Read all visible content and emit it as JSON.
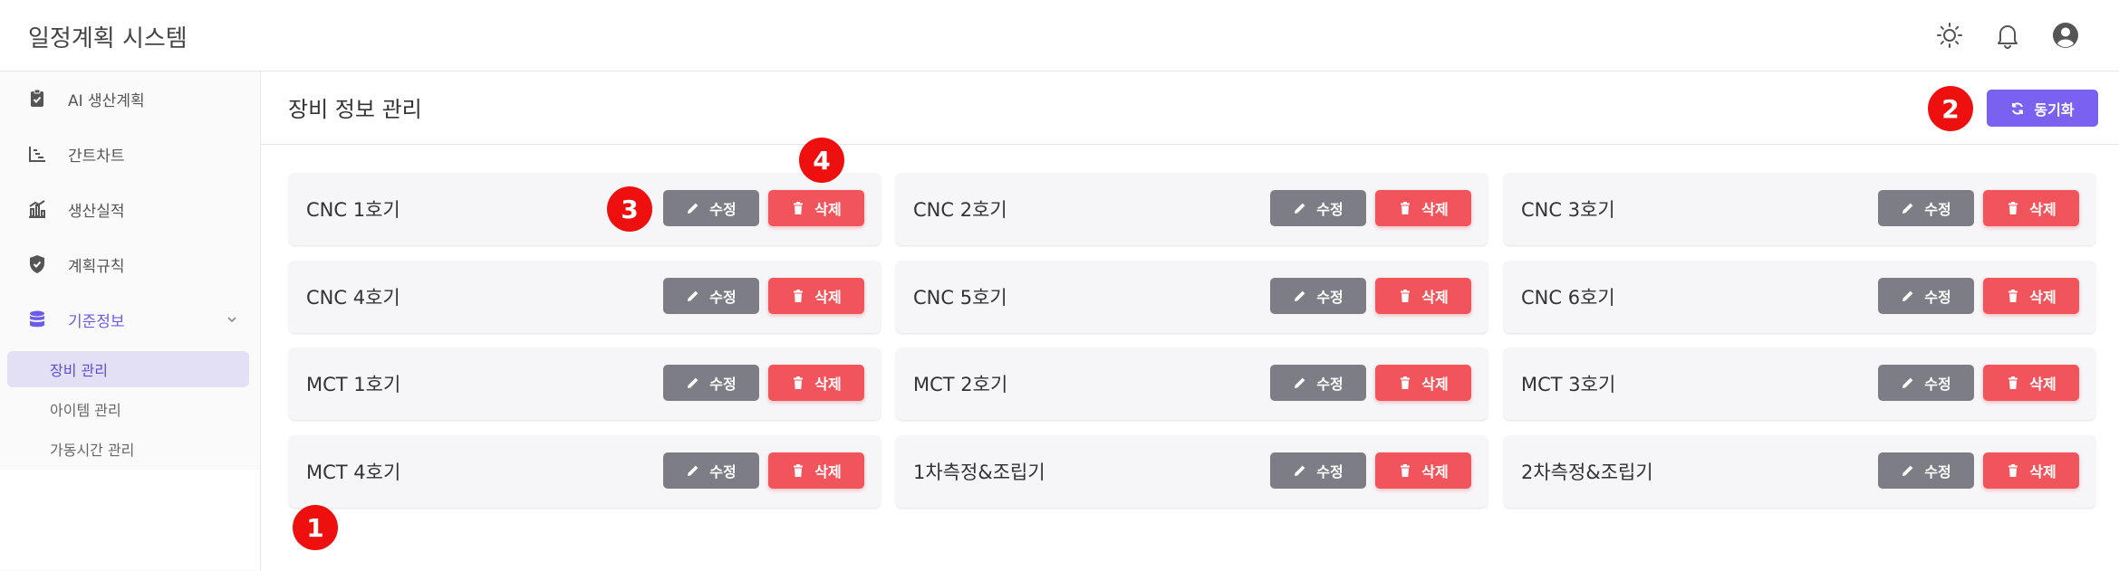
{
  "header": {
    "app_title": "일정계획 시스템",
    "icons": [
      "sun-icon",
      "bell-icon",
      "user-avatar-icon"
    ]
  },
  "sidebar": {
    "items": [
      {
        "label": "AI 생산계획",
        "icon": "clipboard-icon"
      },
      {
        "label": "간트차트",
        "icon": "chart-icon"
      },
      {
        "label": "생산실적",
        "icon": "bar-chart-icon"
      },
      {
        "label": "계획규칙",
        "icon": "shield-icon"
      },
      {
        "label": "기준정보",
        "icon": "database-icon"
      }
    ],
    "sub_items": [
      {
        "label": "장비 관리"
      },
      {
        "label": "아이템 관리"
      },
      {
        "label": "가동시간 관리"
      }
    ]
  },
  "main": {
    "page_title": "장비 정보 관리",
    "sync_label": "동기화",
    "edit_label": "수정",
    "delete_label": "삭제",
    "equipment": [
      {
        "name": "CNC 1호기"
      },
      {
        "name": "CNC 2호기"
      },
      {
        "name": "CNC 3호기"
      },
      {
        "name": "CNC 4호기"
      },
      {
        "name": "CNC 5호기"
      },
      {
        "name": "CNC 6호기"
      },
      {
        "name": "MCT 1호기"
      },
      {
        "name": "MCT 2호기"
      },
      {
        "name": "MCT 3호기"
      },
      {
        "name": "MCT 4호기"
      },
      {
        "name": "1차측정&조립기"
      },
      {
        "name": "2차측정&조립기"
      }
    ]
  },
  "markers": [
    "1",
    "2",
    "3",
    "4"
  ],
  "colors": {
    "accent": "#7b61f0",
    "edit": "#7d7d86",
    "delete": "#f2545b",
    "marker": "#ee0f0f"
  }
}
